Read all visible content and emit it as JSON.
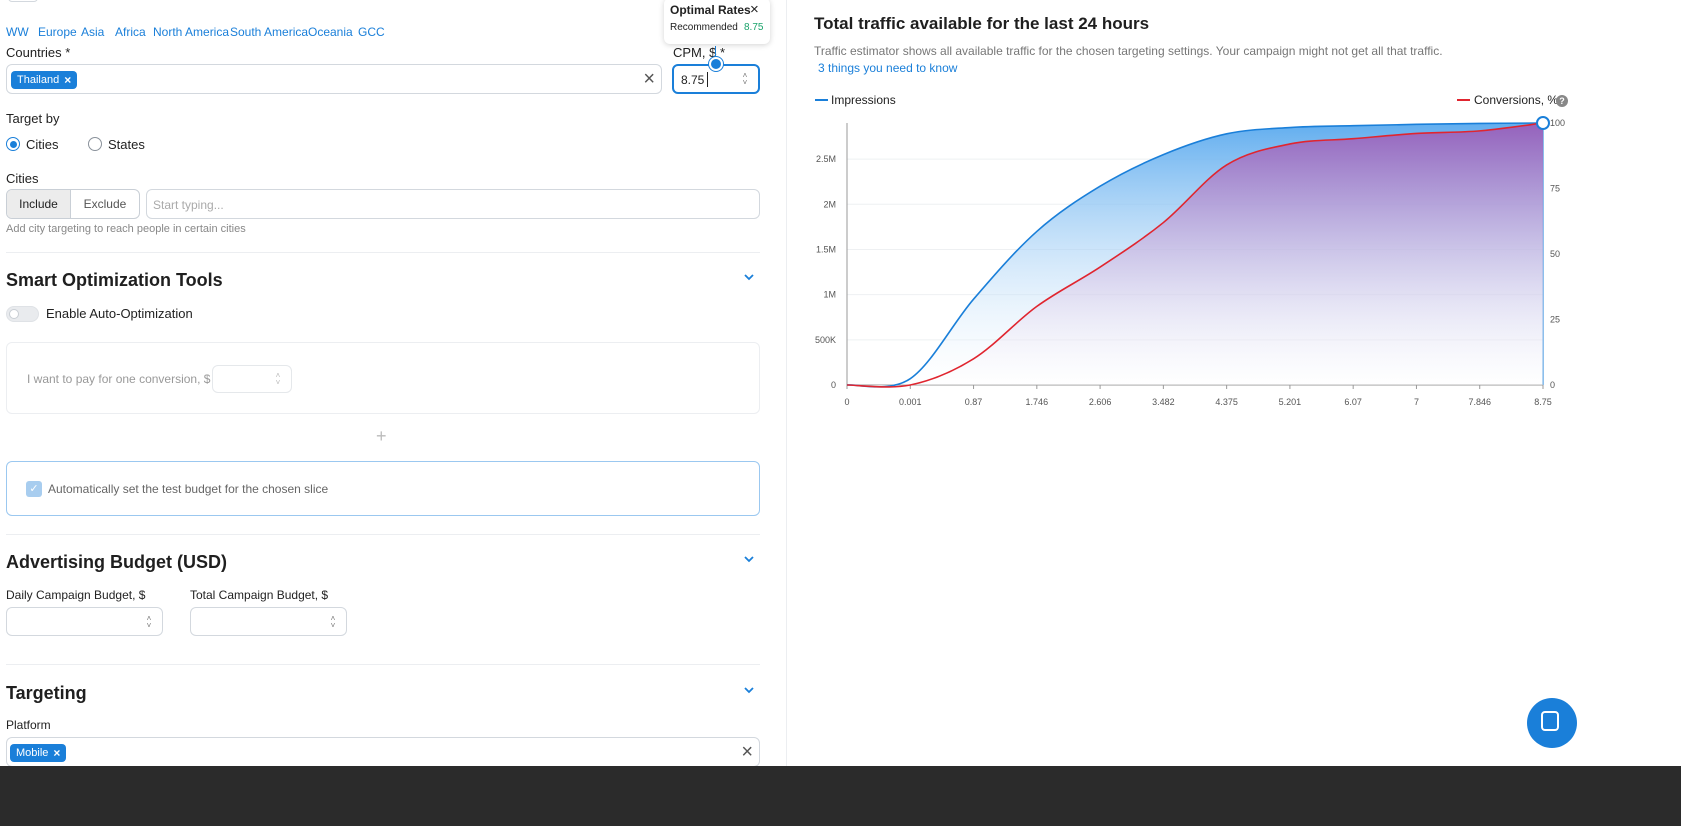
{
  "regions": [
    "WW",
    "Europe",
    "Asia",
    "Africa",
    "North America",
    "South America",
    "Oceania",
    "GCC"
  ],
  "countries": {
    "label": "Countries *",
    "selected": "Thailand"
  },
  "cpm": {
    "label": "CPM, $ *",
    "value": "8.75"
  },
  "optimal_rates": {
    "title": "Optimal Rates",
    "recommended_label": "Recommended",
    "recommended_value": "8.75"
  },
  "target_by": {
    "label": "Target by",
    "options": [
      "Cities",
      "States"
    ],
    "selected": "Cities"
  },
  "cities": {
    "label": "Cities",
    "include_label": "Include",
    "exclude_label": "Exclude",
    "placeholder": "Start typing...",
    "hint": "Add city targeting to reach people in certain cities"
  },
  "smart_tools": {
    "title": "Smart Optimization Tools",
    "toggle_label": "Enable Auto-Optimization",
    "pay_label": "I want to pay for one conversion, $",
    "add_label": "+",
    "auto_budget_label": "Automatically set the test budget for the chosen slice"
  },
  "budget": {
    "title": "Advertising Budget (USD)",
    "daily_label": "Daily Campaign Budget, $",
    "total_label": "Total Campaign Budget, $"
  },
  "targeting": {
    "title": "Targeting",
    "platform_label": "Platform",
    "platform_selected": "Mobile"
  },
  "estimator": {
    "title": "Total traffic available for the last 24 hours",
    "description": "Traffic estimator shows all available traffic for the chosen targeting settings. Your campaign might not get all that traffic.",
    "link": "3 things you need to know"
  },
  "colors": {
    "accent": "#1a7fd9",
    "impressions": "#1a7fd9",
    "conversions": "#e0252f",
    "area_purple": "#9b59b6",
    "recommended": "#1aa36b"
  },
  "chart_data": {
    "type": "area",
    "x": [
      "0",
      "0.001",
      "0.87",
      "1.746",
      "2.606",
      "3.482",
      "4.375",
      "5.201",
      "6.07",
      "7",
      "7.846",
      "8.75"
    ],
    "series": [
      {
        "name": "Impressions",
        "axis": "left",
        "values": [
          0,
          70000,
          950000,
          1700000,
          2200000,
          2550000,
          2780000,
          2850000,
          2870000,
          2885000,
          2895000,
          2900000
        ]
      },
      {
        "name": "Conversions, %",
        "axis": "right",
        "values": [
          0,
          0,
          10,
          30,
          45,
          62,
          84,
          92,
          94,
          96,
          97,
          100
        ]
      }
    ],
    "y_left_ticks": [
      "0",
      "500K",
      "1M",
      "1.5M",
      "2M",
      "2.5M"
    ],
    "y_right_ticks": [
      "0",
      "25",
      "50",
      "75",
      "100"
    ],
    "y_left_range": [
      0,
      2900000
    ],
    "y_right_range": [
      0,
      100
    ],
    "legend": "top",
    "grid": true
  }
}
